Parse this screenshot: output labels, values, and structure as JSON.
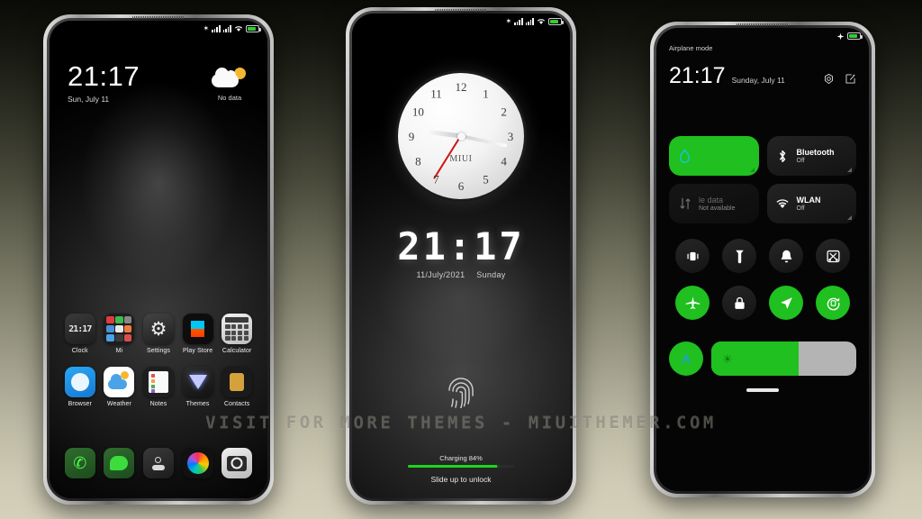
{
  "watermark": "VISIT FOR MORE THEMES - MIUITHEMER.COM",
  "phone1": {
    "status_icons": [
      "bluetooth-icon",
      "signal-icon",
      "signal-icon",
      "wifi-icon",
      "battery-icon"
    ],
    "clock": {
      "time": "21:17",
      "date": "Sun, July 11"
    },
    "weather": {
      "label": "No data",
      "icon": "sun-cloud-icon"
    },
    "apps": [
      {
        "label": "Clock",
        "icon": "clock-app-icon",
        "digits": "21:17"
      },
      {
        "label": "Mi",
        "icon": "mi-apps-folder-icon"
      },
      {
        "label": "Settings",
        "icon": "settings-gear-icon"
      },
      {
        "label": "Play Store",
        "icon": "play-store-icon"
      },
      {
        "label": "Calculator",
        "icon": "calculator-icon"
      },
      {
        "label": "Browser",
        "icon": "browser-icon"
      },
      {
        "label": "Weather",
        "icon": "weather-icon"
      },
      {
        "label": "Notes",
        "icon": "notes-icon"
      },
      {
        "label": "Themes",
        "icon": "themes-diamond-icon"
      },
      {
        "label": "Contacts",
        "icon": "contacts-icon"
      }
    ],
    "dock": [
      {
        "name": "phone-dialer",
        "icon": "phone-handset-icon"
      },
      {
        "name": "messages",
        "icon": "message-bubble-icon"
      },
      {
        "name": "security",
        "icon": "security-shield-icon"
      },
      {
        "name": "gallery",
        "icon": "gallery-flower-icon"
      },
      {
        "name": "camera",
        "icon": "camera-icon"
      }
    ]
  },
  "phone2": {
    "status_icons": [
      "bluetooth-icon",
      "signal-icon",
      "signal-icon",
      "wifi-icon",
      "battery-icon"
    ],
    "analog_clock": {
      "brand": "MIUI",
      "numerals": [
        "12",
        "1",
        "2",
        "3",
        "4",
        "5",
        "6",
        "7",
        "8",
        "9",
        "10",
        "11"
      ],
      "hour_angle": 277,
      "minute_angle": 102,
      "second_angle": 212
    },
    "digital": {
      "time": "21:17",
      "date": "11/July/2021",
      "weekday": "Sunday"
    },
    "fingerprint_icon": "fingerprint-icon",
    "charging": {
      "label": "Charging 84%",
      "percent": 84
    },
    "unlock_hint": "Slide up  to unlock"
  },
  "phone3": {
    "airplane_label": "Airplane mode",
    "status_icons": [
      "airplane-icon",
      "battery-icon"
    ],
    "time": "21:17",
    "date": "Sunday, July 11",
    "actions": [
      {
        "name": "settings-icon"
      },
      {
        "name": "edit-icon"
      }
    ],
    "tiles": [
      {
        "name": "mobile-hotspot",
        "title": "",
        "subtitle": "",
        "state": "on",
        "icon": "droplet-icon"
      },
      {
        "name": "bluetooth",
        "title": "Bluetooth",
        "subtitle": "Off",
        "state": "off",
        "icon": "bluetooth-icon"
      },
      {
        "name": "mobile-data",
        "title": "le data",
        "subtitle": "Not available",
        "state": "dim",
        "icon": "data-arrows-icon"
      },
      {
        "name": "wlan",
        "title": "WLAN",
        "subtitle": "Off",
        "state": "off",
        "icon": "wifi-icon"
      }
    ],
    "circles": [
      {
        "name": "vibrate",
        "state": "off",
        "icon": "vibrate-icon"
      },
      {
        "name": "flashlight",
        "state": "off",
        "icon": "flashlight-icon"
      },
      {
        "name": "do-not-disturb",
        "state": "off",
        "icon": "bell-icon"
      },
      {
        "name": "screenshot",
        "state": "off",
        "icon": "screenshot-icon"
      },
      {
        "name": "airplane-mode",
        "state": "on",
        "icon": "airplane-icon"
      },
      {
        "name": "lock-screen",
        "state": "on",
        "icon": "lock-icon"
      },
      {
        "name": "location",
        "state": "on",
        "icon": "location-arrow-icon"
      },
      {
        "name": "auto-rotate",
        "state": "on",
        "icon": "auto-rotate-icon"
      }
    ],
    "brightness": {
      "auto_label": "A",
      "percent": 60,
      "icon": "brightness-sun-icon"
    }
  }
}
